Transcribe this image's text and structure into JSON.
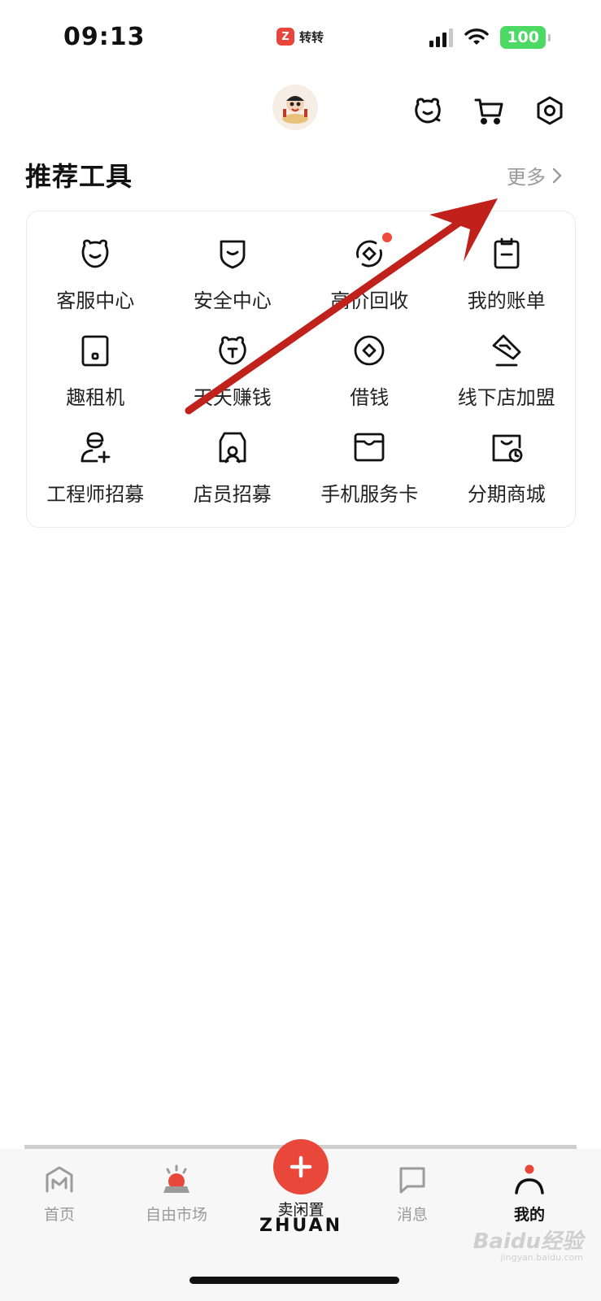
{
  "status_bar": {
    "time": "09:13",
    "app_name": "转转",
    "battery": "100",
    "signal_bars": 4,
    "signal_active": 3,
    "colors": {
      "battery": "#4cd964"
    }
  },
  "header": {
    "avatar_icon": "cartoon-avatar",
    "icons": [
      "customer-service-icon",
      "cart-icon",
      "settings-icon"
    ]
  },
  "tools_section": {
    "title": "推荐工具",
    "more_label": "更多",
    "items": [
      {
        "label": "客服中心",
        "icon": "bear-face-icon"
      },
      {
        "label": "安全中心",
        "icon": "shield-icon"
      },
      {
        "label": "高价回收",
        "icon": "recycle-icon",
        "badge": true
      },
      {
        "label": "我的账单",
        "icon": "clipboard-icon"
      },
      {
        "label": "趣租机",
        "icon": "tablet-icon"
      },
      {
        "label": "天天赚钱",
        "icon": "money-bag-icon"
      },
      {
        "label": "借钱",
        "icon": "coin-icon"
      },
      {
        "label": "线下店加盟",
        "icon": "handshake-icon"
      },
      {
        "label": "工程师招募",
        "icon": "engineer-icon"
      },
      {
        "label": "店员招募",
        "icon": "clerk-icon"
      },
      {
        "label": "手机服务卡",
        "icon": "service-card-icon"
      },
      {
        "label": "分期商城",
        "icon": "installment-icon"
      }
    ]
  },
  "bottom_nav": {
    "items": [
      {
        "label": "首页",
        "icon": "home-icon"
      },
      {
        "label": "自由市场",
        "icon": "market-icon"
      },
      {
        "label": "卖闲置",
        "icon": "plus-icon"
      },
      {
        "label": "消息",
        "icon": "message-icon"
      },
      {
        "label": "我的",
        "icon": "profile-icon",
        "active": true
      }
    ],
    "brand": "ZHUAN"
  },
  "watermark": {
    "text": "Baidu经验",
    "sub": "jingyan.baidu.com"
  },
  "colors": {
    "accent": "#e9473a",
    "badge": "#f04a3c",
    "arrow": "#c0211b"
  }
}
